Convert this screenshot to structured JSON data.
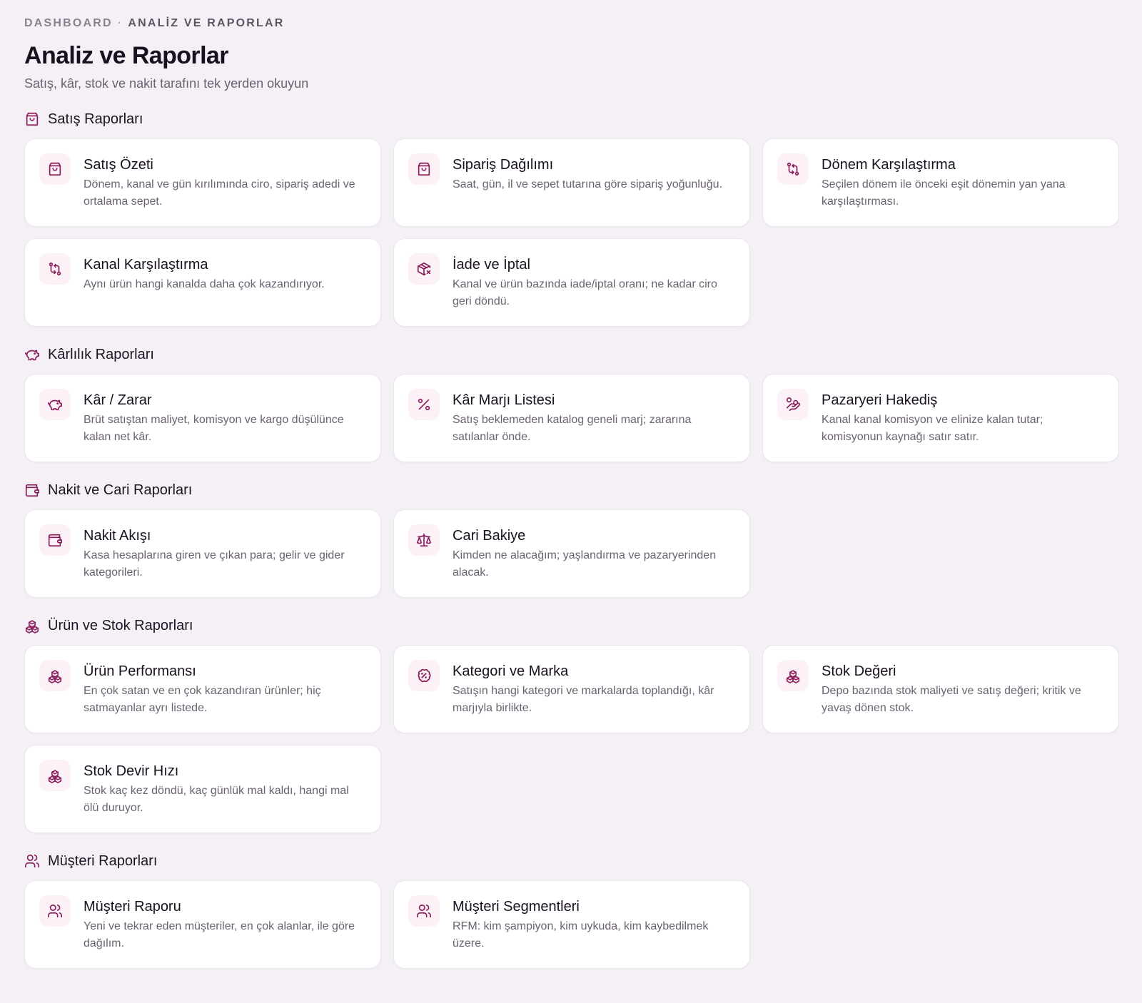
{
  "breadcrumb": {
    "root": "DASHBOARD",
    "separator": "·",
    "current": "ANALİZ VE RAPORLAR"
  },
  "header": {
    "title": "Analiz ve Raporlar",
    "subtitle": "Satış, kâr, stok ve nakit tarafını tek yerden okuyun"
  },
  "accent_color": "#8a1c5c",
  "sections": [
    {
      "title": "Satış Raporları",
      "icon": "shopping-bag-icon",
      "cards": [
        {
          "title": "Satış Özeti",
          "desc": "Dönem, kanal ve gün kırılımında ciro, sipariş adedi ve ortalama sepet.",
          "icon": "shopping-bag-icon"
        },
        {
          "title": "Sipariş Dağılımı",
          "desc": "Saat, gün, il ve sepet tutarına göre sipariş yoğunluğu.",
          "icon": "shopping-bag-icon"
        },
        {
          "title": "Dönem Karşılaştırma",
          "desc": "Seçilen dönem ile önceki eşit dönemin yan yana karşılaştırması.",
          "icon": "compare-arrows-icon"
        },
        {
          "title": "Kanal Karşılaştırma",
          "desc": "Aynı ürün hangi kanalda daha çok kazandırıyor.",
          "icon": "compare-arrows-icon"
        },
        {
          "title": "İade ve İptal",
          "desc": "Kanal ve ürün bazında iade/iptal oranı; ne kadar ciro geri döndü.",
          "icon": "package-x-icon"
        }
      ]
    },
    {
      "title": "Kârlılık Raporları",
      "icon": "piggy-bank-icon",
      "cards": [
        {
          "title": "Kâr / Zarar",
          "desc": "Brüt satıştan maliyet, komisyon ve kargo düşülünce kalan net kâr.",
          "icon": "piggy-bank-icon"
        },
        {
          "title": "Kâr Marjı Listesi",
          "desc": "Satış beklemeden katalog geneli marj; zararına satılanlar önde.",
          "icon": "percent-icon"
        },
        {
          "title": "Pazaryeri Hakediş",
          "desc": "Kanal kanal komisyon ve elinize kalan tutar; komisyonun kaynağı satır satır.",
          "icon": "hand-coins-icon"
        }
      ]
    },
    {
      "title": "Nakit ve Cari Raporları",
      "icon": "wallet-icon",
      "cards": [
        {
          "title": "Nakit Akışı",
          "desc": "Kasa hesaplarına giren ve çıkan para; gelir ve gider kategorileri.",
          "icon": "wallet-icon"
        },
        {
          "title": "Cari Bakiye",
          "desc": "Kimden ne alacağım; yaşlandırma ve pazaryerinden alacak.",
          "icon": "scale-icon"
        }
      ]
    },
    {
      "title": "Ürün ve Stok Raporları",
      "icon": "boxes-icon",
      "cards": [
        {
          "title": "Ürün Performansı",
          "desc": "En çok satan ve en çok kazandıran ürünler; hiç satmayanlar ayrı listede.",
          "icon": "boxes-icon"
        },
        {
          "title": "Kategori ve Marka",
          "desc": "Satışın hangi kategori ve markalarda toplandığı, kâr marjıyla birlikte.",
          "icon": "badge-percent-icon"
        },
        {
          "title": "Stok Değeri",
          "desc": "Depo bazında stok maliyeti ve satış değeri; kritik ve yavaş dönen stok.",
          "icon": "boxes-icon"
        },
        {
          "title": "Stok Devir Hızı",
          "desc": "Stok kaç kez döndü, kaç günlük mal kaldı, hangi mal ölü duruyor.",
          "icon": "boxes-icon"
        }
      ]
    },
    {
      "title": "Müşteri Raporları",
      "icon": "users-icon",
      "cards": [
        {
          "title": "Müşteri Raporu",
          "desc": "Yeni ve tekrar eden müşteriler, en çok alanlar, ile göre dağılım.",
          "icon": "users-icon"
        },
        {
          "title": "Müşteri Segmentleri",
          "desc": "RFM: kim şampiyon, kim uykuda, kim kaybedilmek üzere.",
          "icon": "users-icon"
        }
      ]
    }
  ]
}
